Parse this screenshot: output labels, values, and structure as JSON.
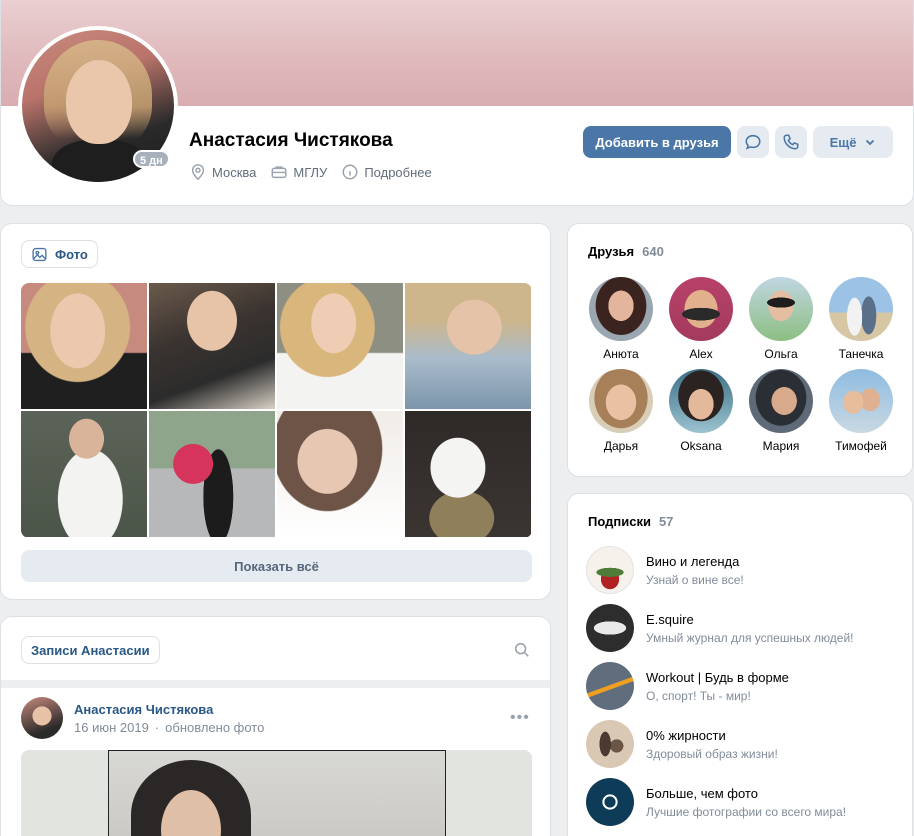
{
  "profile": {
    "name": "Анастасия Чистякова",
    "online_badge": "5 дн",
    "city": "Москва",
    "education": "МГЛУ",
    "details": "Подробнее"
  },
  "actions": {
    "add_friend": "Добавить в друзья",
    "more": "Ещё"
  },
  "photos": {
    "title": "Фото",
    "show_all": "Показать всё"
  },
  "wall": {
    "title": "Записи Анастасии",
    "post": {
      "author": "Анастасия Чистякова",
      "date": "16 июн 2019",
      "separator": "·",
      "action": "обновлено фото"
    }
  },
  "friends": {
    "title": "Друзья",
    "count": "640",
    "items": [
      {
        "name": "Анюта"
      },
      {
        "name": "Alex"
      },
      {
        "name": "Ольга"
      },
      {
        "name": "Танечка"
      },
      {
        "name": "Дарья"
      },
      {
        "name": "Oksana"
      },
      {
        "name": "Мария"
      },
      {
        "name": "Тимофей"
      }
    ]
  },
  "subscriptions": {
    "title": "Подписки",
    "count": "57",
    "items": [
      {
        "name": "Вино и легенда",
        "desc": "Узнай о вине все!"
      },
      {
        "name": "E.squire",
        "desc": "Умный журнал для успешных людей!"
      },
      {
        "name": "Workout | Будь в форме",
        "desc": "О, спорт! Ты - мир!"
      },
      {
        "name": "0% жирности",
        "desc": "Здоровый образ жизни!"
      },
      {
        "name": "Больше, чем фото",
        "desc": "Лучшие фотографии со всего мира!"
      }
    ]
  },
  "colors": {
    "accent": "#4a76a8",
    "link": "#2a5885",
    "secondary_text": "#818c99",
    "button_bg": "#e5ebf1",
    "page_bg": "#edeef0"
  }
}
